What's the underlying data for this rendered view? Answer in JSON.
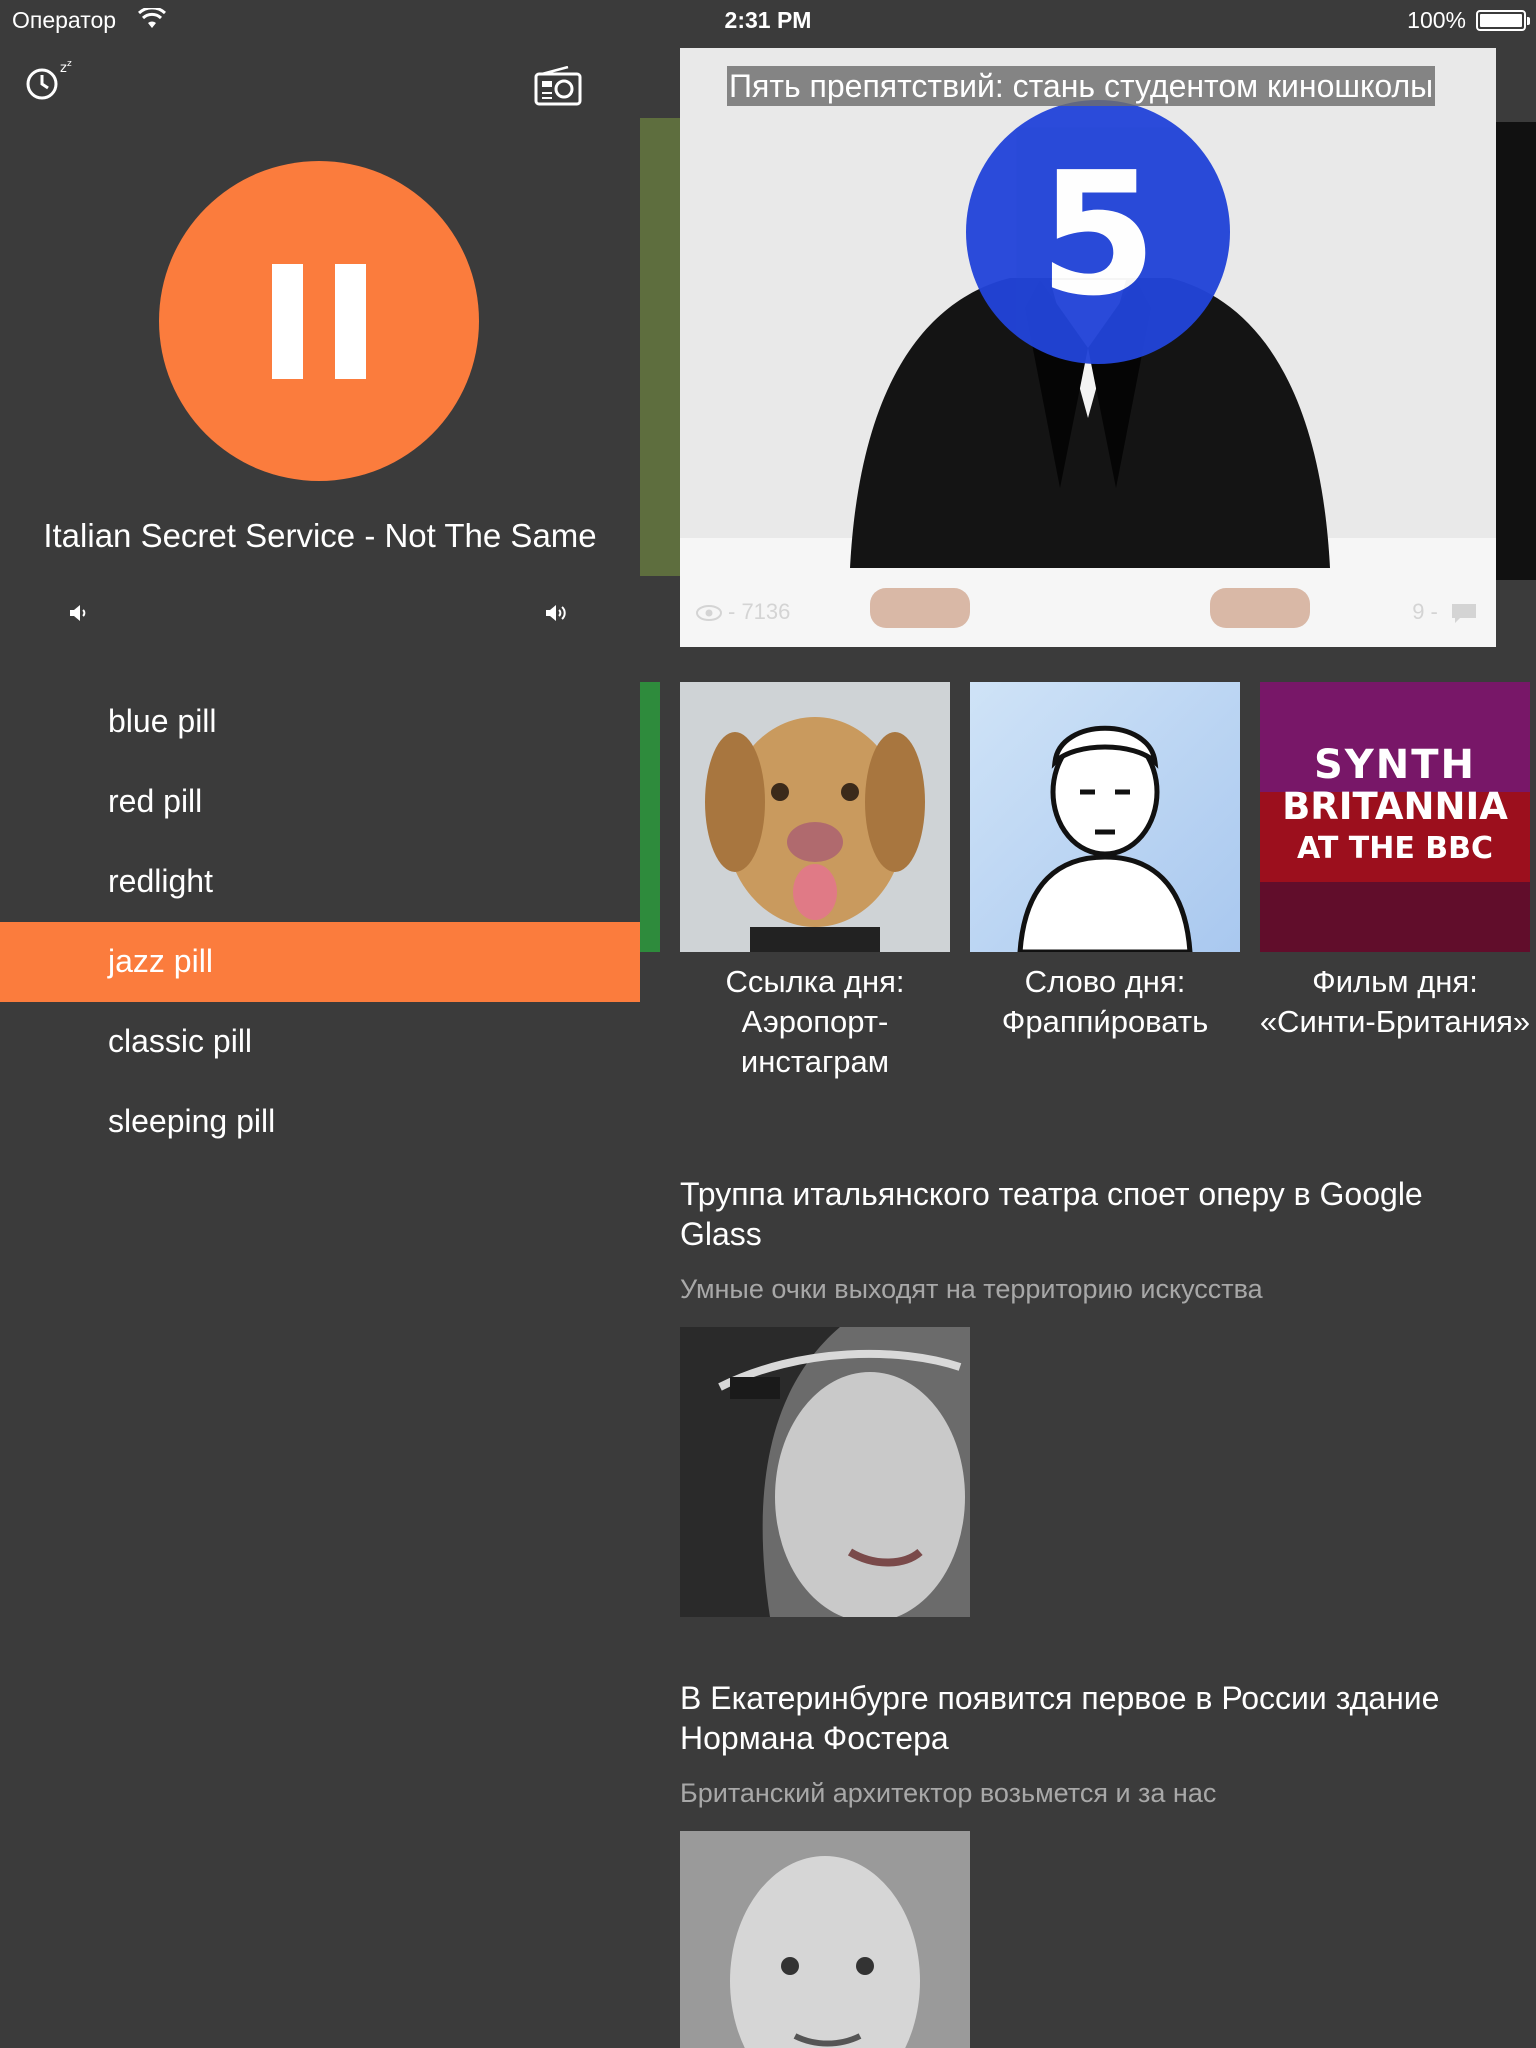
{
  "status_bar": {
    "carrier": "Оператор",
    "time": "2:31 PM",
    "battery": "100%"
  },
  "player": {
    "track_title": "Italian Secret Service - Not The Same",
    "state": "playing",
    "accent_color": "#fb7c3d",
    "stations": [
      {
        "label": "blue pill",
        "active": false
      },
      {
        "label": "red pill",
        "active": false
      },
      {
        "label": "redlight",
        "active": false
      },
      {
        "label": "jazz pill",
        "active": true
      },
      {
        "label": "classic pill",
        "active": false
      },
      {
        "label": "sleeping pill",
        "active": false
      }
    ]
  },
  "hero": {
    "title": "Пять препятствий: стань студентом киношколы",
    "badge_number": "5",
    "views": "- 7136",
    "comments": "9 -"
  },
  "tiles": [
    {
      "caption": "Ссылка дня: Аэропорт-инстаграм",
      "image": "dog-photo"
    },
    {
      "caption": "Слово дня: Фраппи́ровать",
      "image": "man-illustration"
    },
    {
      "caption": "Фильм дня: «Синти-Британия»",
      "image": "synth-britannia-poster",
      "poster_text": [
        "SYNTH",
        "BRITANNIA",
        "AT THE",
        "BBC"
      ]
    }
  ],
  "articles": [
    {
      "title": "Труппа итальянского театра споет оперу в Google Glass",
      "subtitle": "Умные очки выходят на территорию искусства",
      "image": "woman-with-google-glass"
    },
    {
      "title": "В Екатеринбурге появится первое в России здание Нормана Фостера",
      "subtitle": "Британский архитектор возьмется и за нас",
      "image": "norman-foster-portrait"
    }
  ]
}
